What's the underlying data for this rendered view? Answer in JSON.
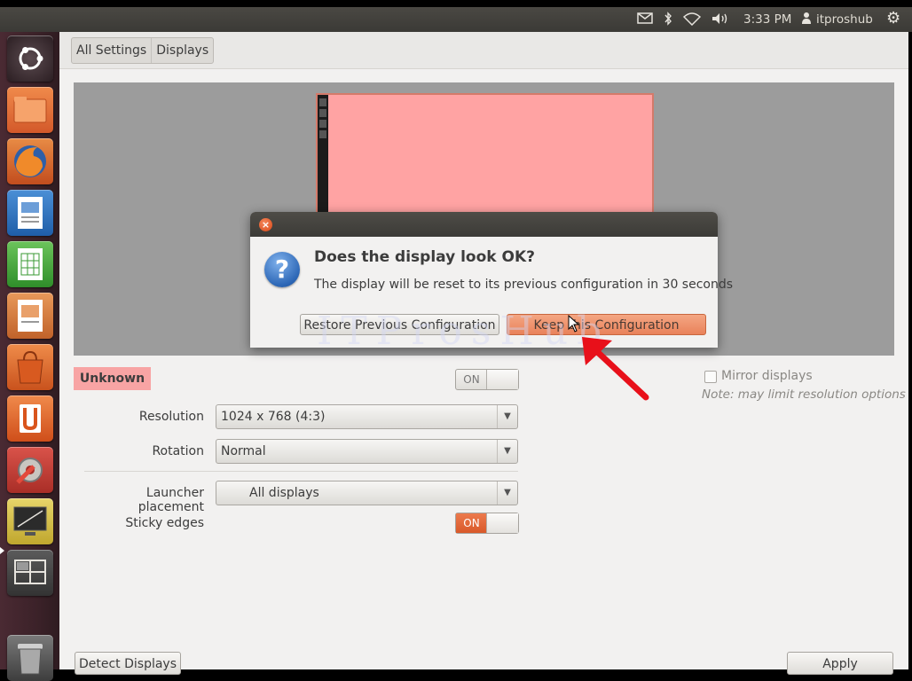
{
  "top_panel": {
    "icons": [
      "mail-icon",
      "bluetooth-icon",
      "wifi-icon",
      "volume-icon"
    ],
    "time": "3:33 PM",
    "user": "itproshub",
    "session_icon": "gear-icon"
  },
  "launcher": {
    "items": [
      "ubuntu-dash",
      "files",
      "firefox",
      "libreoffice-writer",
      "libreoffice-calc",
      "libreoffice-impress",
      "ubuntu-software-center",
      "ubuntu-one",
      "system-settings",
      "displays",
      "workspace-switcher",
      "trash"
    ]
  },
  "breadcrumb": [
    "All Settings",
    "Displays"
  ],
  "preview": {
    "watermark": "ITProsHub",
    "monitor_color": "#ffa3a3"
  },
  "dialog": {
    "heading": "Does the display look OK?",
    "body": "The display will be reset to its previous configuration in 30 seconds",
    "restore_button": "Restore Previous Configuration",
    "keep_button": "Keep this Configuration"
  },
  "display": {
    "name": "Unknown",
    "power_toggle": "ON",
    "resolution_label": "Resolution",
    "resolution": "1024 x 768 (4:3)",
    "rotation_label": "Rotation",
    "rotation": "Normal",
    "launcher_label": "Launcher placement",
    "launcher_placement": "All displays",
    "sticky_label": "Sticky edges",
    "sticky_toggle": "ON"
  },
  "mirror": {
    "label": "Mirror displays",
    "note": "Note: may limit resolution options",
    "checked": false
  },
  "footer": {
    "detect_button": "Detect Displays",
    "apply_button": "Apply"
  },
  "colors": {
    "accent": "#e9825a",
    "unknown_label_bg": "#f8a4a4",
    "launcher_bg": "#3c2229"
  }
}
